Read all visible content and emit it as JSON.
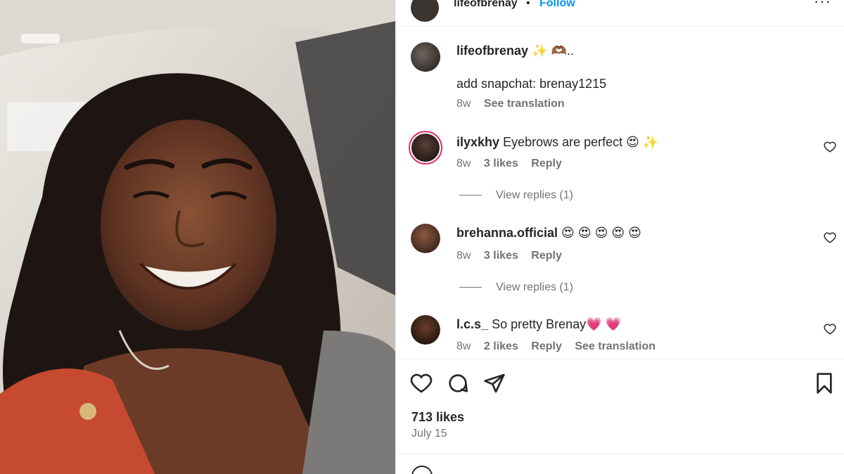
{
  "post": {
    "username": "lifeofbrenay",
    "separator": "•",
    "follow_label": "Follow",
    "more_label": "···"
  },
  "caption": {
    "username": "lifeofbrenay",
    "emoji": "✨ 🫶🏾..",
    "text": "add snapchat: brenay1215",
    "time": "8w",
    "translate": "See translation"
  },
  "comments": [
    {
      "username": "ilyxkhy",
      "text": "Eyebrows are perfect 😍 ✨",
      "time": "8w",
      "likes": "3 likes",
      "reply": "Reply",
      "view_replies": "View replies (1)"
    },
    {
      "username": "brehanna.official",
      "text": "😍 😍 😍 😍 😍",
      "time": "8w",
      "likes": "3 likes",
      "reply": "Reply",
      "view_replies": "View replies (1)"
    },
    {
      "username": "l.c.s_",
      "text": "So pretty Brenay💗 💗",
      "time": "8w",
      "likes": "2 likes",
      "reply": "Reply",
      "translate": "See translation"
    }
  ],
  "stats": {
    "likes": "713 likes",
    "date": "July 15"
  },
  "icons": {
    "like": "heart-icon",
    "comment": "comment-icon",
    "share": "share-icon",
    "save": "bookmark-icon",
    "comment_like": "heart-icon"
  },
  "colors": {
    "follow": "#0095f6",
    "secondary_text": "#737373",
    "primary_text": "#262626",
    "story_ring": "#e1306c"
  }
}
